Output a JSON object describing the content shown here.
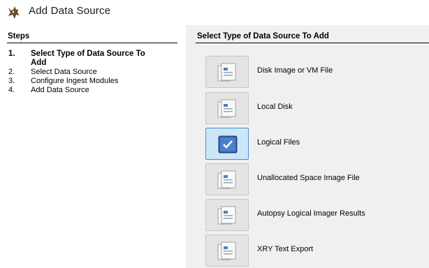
{
  "window": {
    "title": "Add Data Source",
    "app_icon": "autopsy-dog-icon"
  },
  "steps_panel": {
    "header": "Steps",
    "steps": [
      {
        "number": "1.",
        "label": "Select Type of Data Source To Add",
        "active": true
      },
      {
        "number": "2.",
        "label": "Select Data Source",
        "active": false
      },
      {
        "number": "3.",
        "label": "Configure Ingest Modules",
        "active": false
      },
      {
        "number": "4.",
        "label": "Add Data Source",
        "active": false
      }
    ]
  },
  "main": {
    "header": "Select Type of Data Source To Add",
    "options": [
      {
        "label": "Disk Image or VM File",
        "icon": "disk-image-icon",
        "selected": false
      },
      {
        "label": "Local Disk",
        "icon": "local-disk-icon",
        "selected": false
      },
      {
        "label": "Logical Files",
        "icon": "logical-files-icon",
        "selected": true
      },
      {
        "label": "Unallocated Space Image File",
        "icon": "unallocated-space-icon",
        "selected": false
      },
      {
        "label": "Autopsy Logical Imager Results",
        "icon": "logical-imager-icon",
        "selected": false
      },
      {
        "label": "XRY Text Export",
        "icon": "xry-export-icon",
        "selected": false
      }
    ]
  },
  "colors": {
    "selected_bg": "#cde6f7",
    "selected_border": "#4a8fcf",
    "panel_bg": "#f0f0f0"
  }
}
